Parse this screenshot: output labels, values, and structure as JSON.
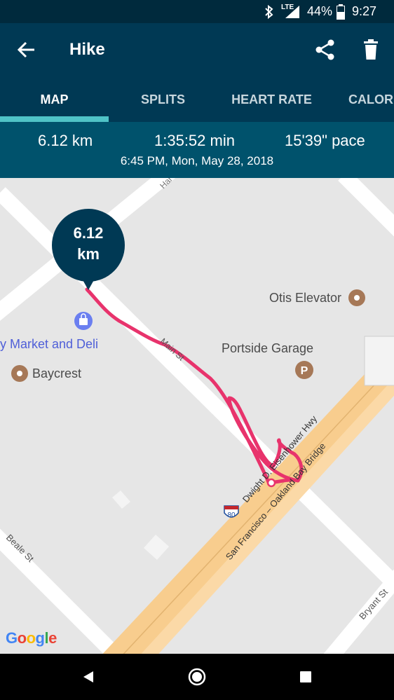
{
  "status_bar": {
    "network": "LTE",
    "battery": "44%",
    "time": "9:27"
  },
  "app_bar": {
    "title": "Hike"
  },
  "tabs": [
    {
      "label": "MAP",
      "active": true
    },
    {
      "label": "SPLITS",
      "active": false
    },
    {
      "label": "HEART RATE",
      "active": false
    },
    {
      "label": "CALORIES",
      "active": false
    }
  ],
  "summary": {
    "distance": "6.12 km",
    "duration": "1:35:52 min",
    "pace": "15'39\" pace",
    "datetime": "6:45 PM, Mon, May 28, 2018"
  },
  "map": {
    "distance_marker": {
      "value": "6.12",
      "unit": "km"
    },
    "places": {
      "otis": "Otis Elevator",
      "portside": "Portside Garage",
      "market": "y Market and Deli",
      "baycrest": "Baycrest"
    },
    "streets": {
      "main": "Main St",
      "beale": "Beale St",
      "bryant": "Bryant St",
      "harrison": "Har",
      "eisenhower": "Dwight D. Eisenhower Hwy",
      "bay_bridge": "San Francisco – Oakland Bay Bridge"
    },
    "highway_shield": "80",
    "attribution": "Google",
    "route_color": "#e8336c"
  },
  "colors": {
    "header": "#003954",
    "summary": "#00526c",
    "tab_indicator": "#4fc3c7"
  }
}
